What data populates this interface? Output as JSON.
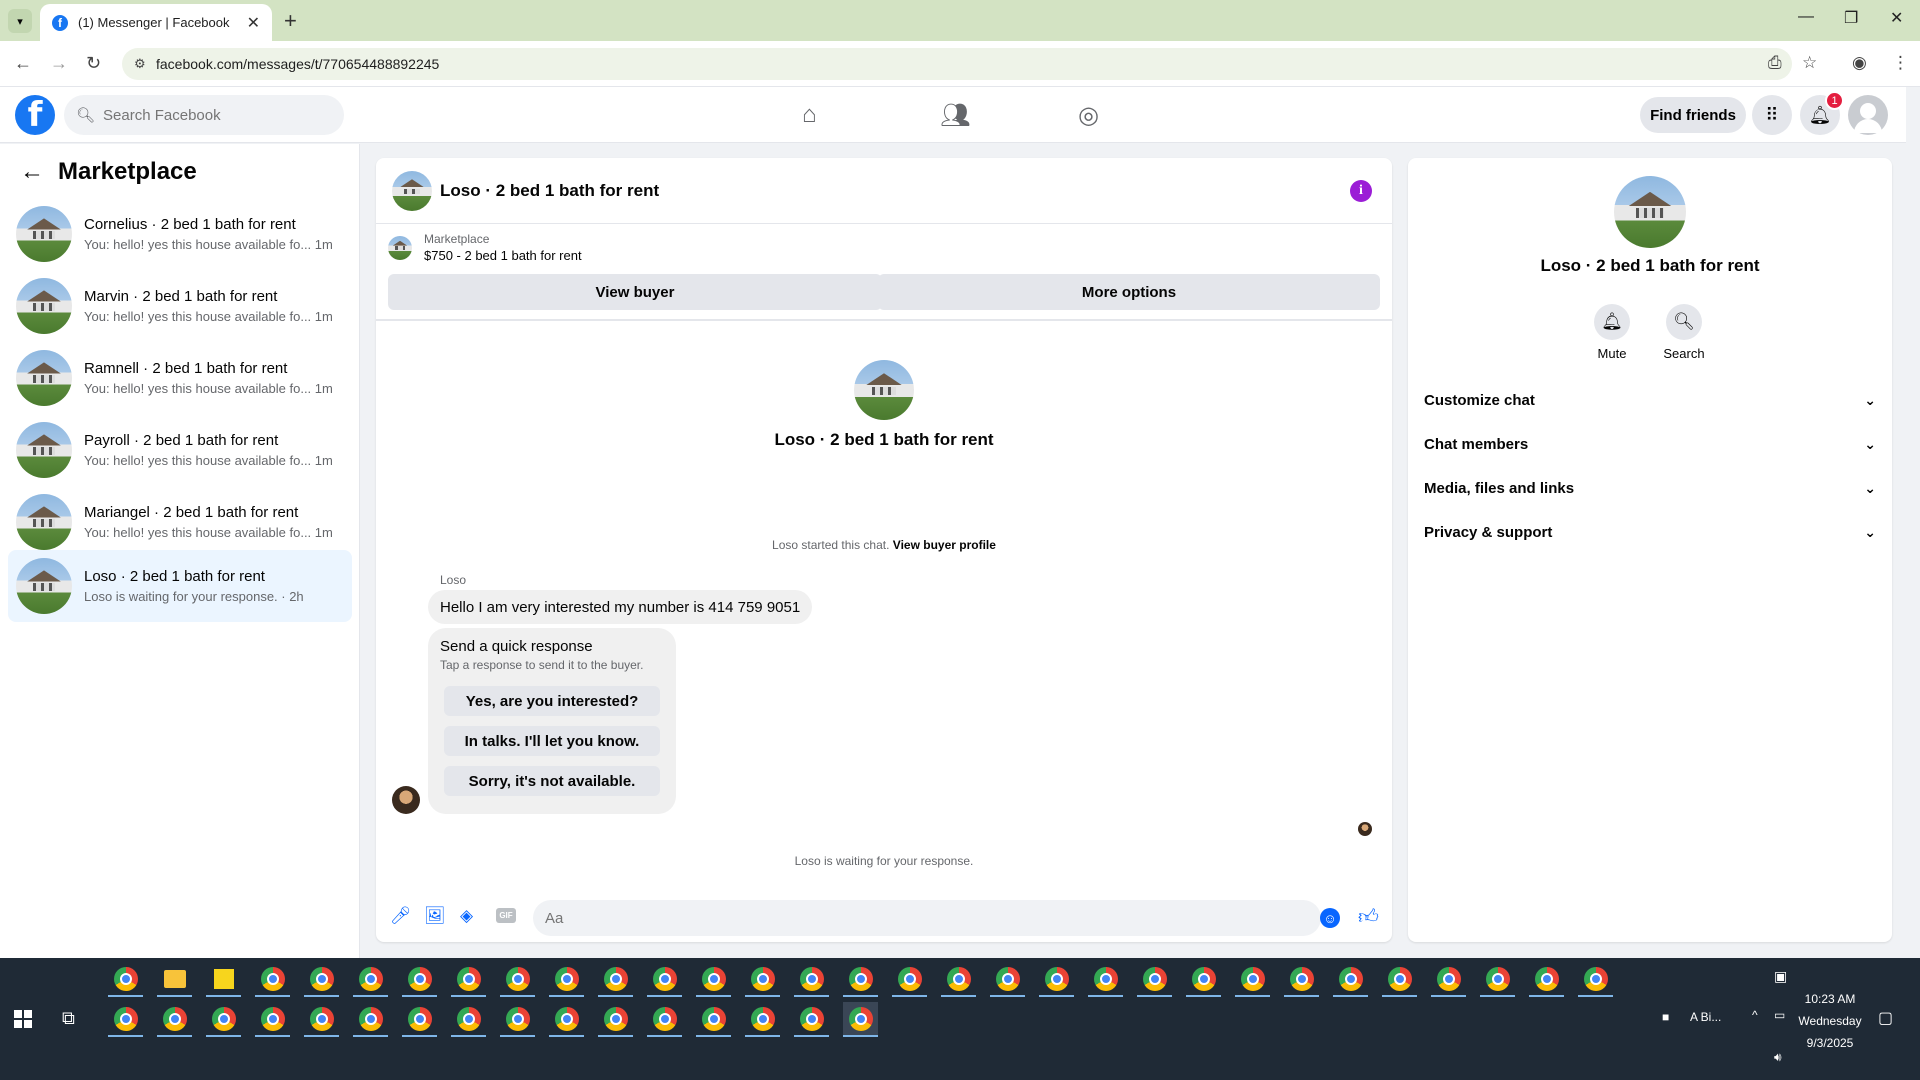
{
  "browser": {
    "tab_title": "(1) Messenger | Facebook",
    "url": "facebook.com/messages/t/770654488892245"
  },
  "header": {
    "search_placeholder": "Search Facebook",
    "find_friends": "Find friends",
    "notification_count": "1"
  },
  "sidebar": {
    "title": "Marketplace",
    "conversations": [
      {
        "title": "Cornelius · 2 bed 1 bath for rent",
        "preview": "You: hello! yes this house available fo...",
        "time": "1m"
      },
      {
        "title": "Marvin · 2 bed 1 bath for rent",
        "preview": "You: hello! yes this house available fo...",
        "time": "1m"
      },
      {
        "title": "Ramnell · 2 bed 1 bath for rent",
        "preview": "You: hello! yes this house available fo...",
        "time": "1m"
      },
      {
        "title": "Payroll · 2 bed 1 bath for rent",
        "preview": "You: hello! yes this house available fo...",
        "time": "1m"
      },
      {
        "title": "Mariangel · 2 bed 1 bath for rent",
        "preview": "You: hello! yes this house available fo...",
        "time": "1m"
      },
      {
        "title": "Loso · 2 bed 1 bath for rent",
        "preview": "Loso is waiting for your response. · 2h",
        "time": ""
      }
    ]
  },
  "chat": {
    "title": "Loso · 2 bed 1 bath for rent",
    "listing_label": "Marketplace",
    "listing_price": "$750 - 2 bed 1 bath for rent",
    "view_buyer": "View buyer",
    "more_options": "More options",
    "center_title": "Loso · 2 bed 1 bath for rent",
    "started_text": "Loso started this chat.",
    "view_buyer_profile": "View buyer profile",
    "sender": "Loso",
    "message": "Hello I am very interested my number is 414 759 9051",
    "quick_title": "Send a quick response",
    "quick_sub": "Tap a response to send it to the buyer.",
    "quick_options": [
      "Yes, are you interested?",
      "In talks. I'll let you know.",
      "Sorry, it's not available."
    ],
    "waiting": "Loso is waiting for your response.",
    "composer_placeholder": "Aa"
  },
  "details": {
    "title": "Loso · 2 bed 1 bath for rent",
    "mute": "Mute",
    "search": "Search",
    "sections": [
      "Customize chat",
      "Chat members",
      "Media, files and links",
      "Privacy & support"
    ]
  },
  "taskbar": {
    "time": "10:23 AM",
    "day": "Wednesday",
    "date": "9/3/2025",
    "app_label": "A Bi..."
  },
  "colors": {
    "brand": "#1877f2",
    "messenger_blue": "#0866ff",
    "info_purple": "#9b1dd6"
  }
}
